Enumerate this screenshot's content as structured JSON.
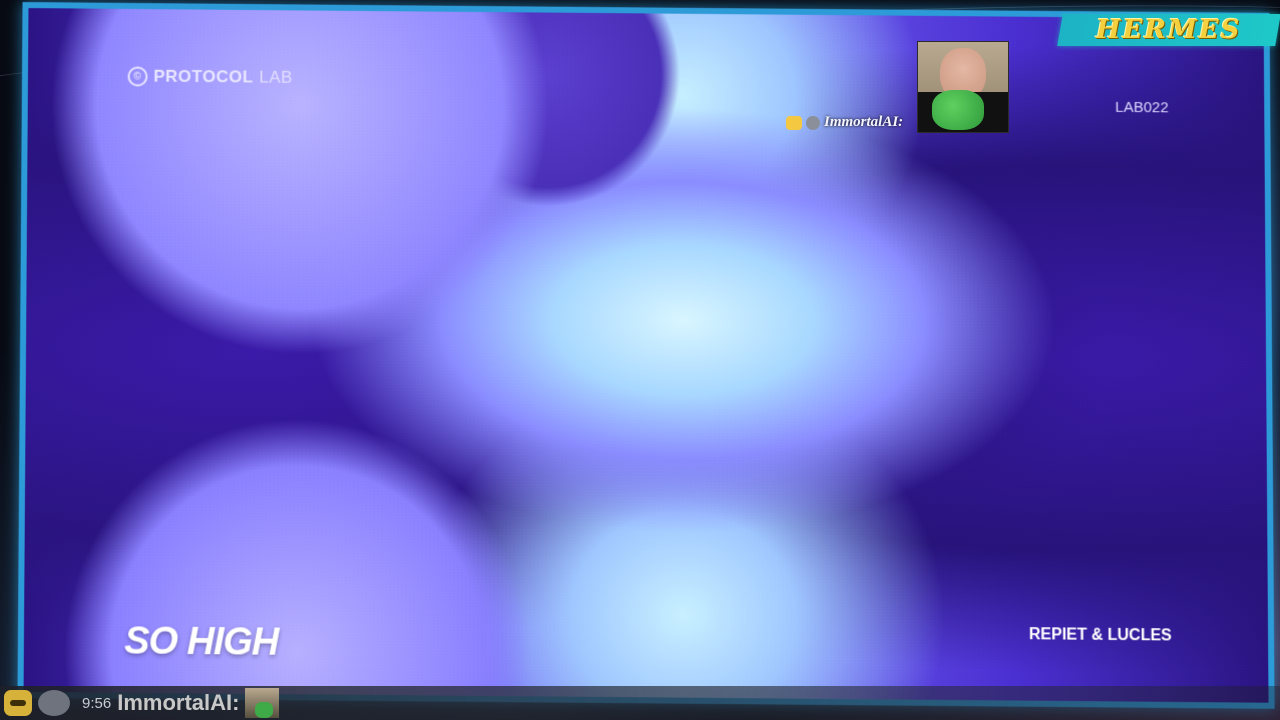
{
  "video": {
    "label_logo": "PROTOCOL",
    "label_logo_suffix": "LAB",
    "catalog_number": "LAB022",
    "track_title": "SO HIGH",
    "artists": "REPIET & LUCLES"
  },
  "overlay": {
    "brand_text": "HERMES",
    "webcam_username": "ImmortalAI:",
    "frame_color": "#2d9bd8"
  },
  "chat": {
    "time": "9:56",
    "username": "ImmortalAI:"
  }
}
